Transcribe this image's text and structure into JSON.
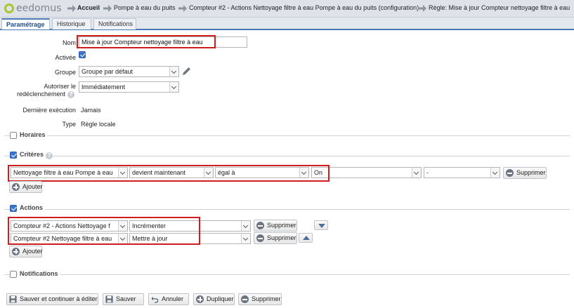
{
  "header": {
    "logo_text": "eedomus",
    "breadcrumbs": [
      "Accueil",
      "Pompe à eau du puits",
      "Compteur #2 - Actions Nettoyage filtre à eau Pompe à eau du puits (configuration)",
      "Règle: Mise à jour Compteur nettoyage filtre à eau"
    ]
  },
  "tabs": [
    "Paramétrage",
    "Historique",
    "Notifications"
  ],
  "form": {
    "name_label": "Nom",
    "name_value": "Mise à jour Compteur nettoyage filtre à eau",
    "enabled_label": "Activée",
    "group_label": "Groupe",
    "group_value": "Groupe par défaut",
    "retrigger_label_1": "Autoriser le",
    "retrigger_label_2": "redéclenchement",
    "retrigger_value": "Immédiatement",
    "last_exec_label": "Dernière exécution",
    "last_exec_value": "Jamais",
    "type_label": "Type",
    "type_value": "Règle locale"
  },
  "sections": {
    "horaires": "Horaires",
    "criteres": "Critères",
    "actions": "Actions",
    "notifications": "Notifications"
  },
  "criteria": {
    "device": "Nettoyage filtre à eau Pompe à eau",
    "condition": "devient maintenant",
    "operator": "égal à",
    "value": "On",
    "extra": "-",
    "delete_label": "Supprimer",
    "add_label": "Ajouter"
  },
  "actions": {
    "rows": [
      {
        "device": "Compteur #2 - Actions Nettoyage f",
        "action": "Incrémenter"
      },
      {
        "device": "Compteur #2 Nettoyage filtre à eau",
        "action": "Mettre à jour"
      }
    ],
    "delete_label": "Supprimer",
    "add_label": "Ajouter"
  },
  "footer": {
    "save_continue": "Sauver et continuer à éditer",
    "save": "Sauver",
    "cancel": "Annuler",
    "duplicate": "Dupliquer",
    "delete": "Supprimer"
  },
  "colors": {
    "accent": "#4a78b5",
    "highlight": "#d01c1c",
    "logo": "#a9c530"
  }
}
